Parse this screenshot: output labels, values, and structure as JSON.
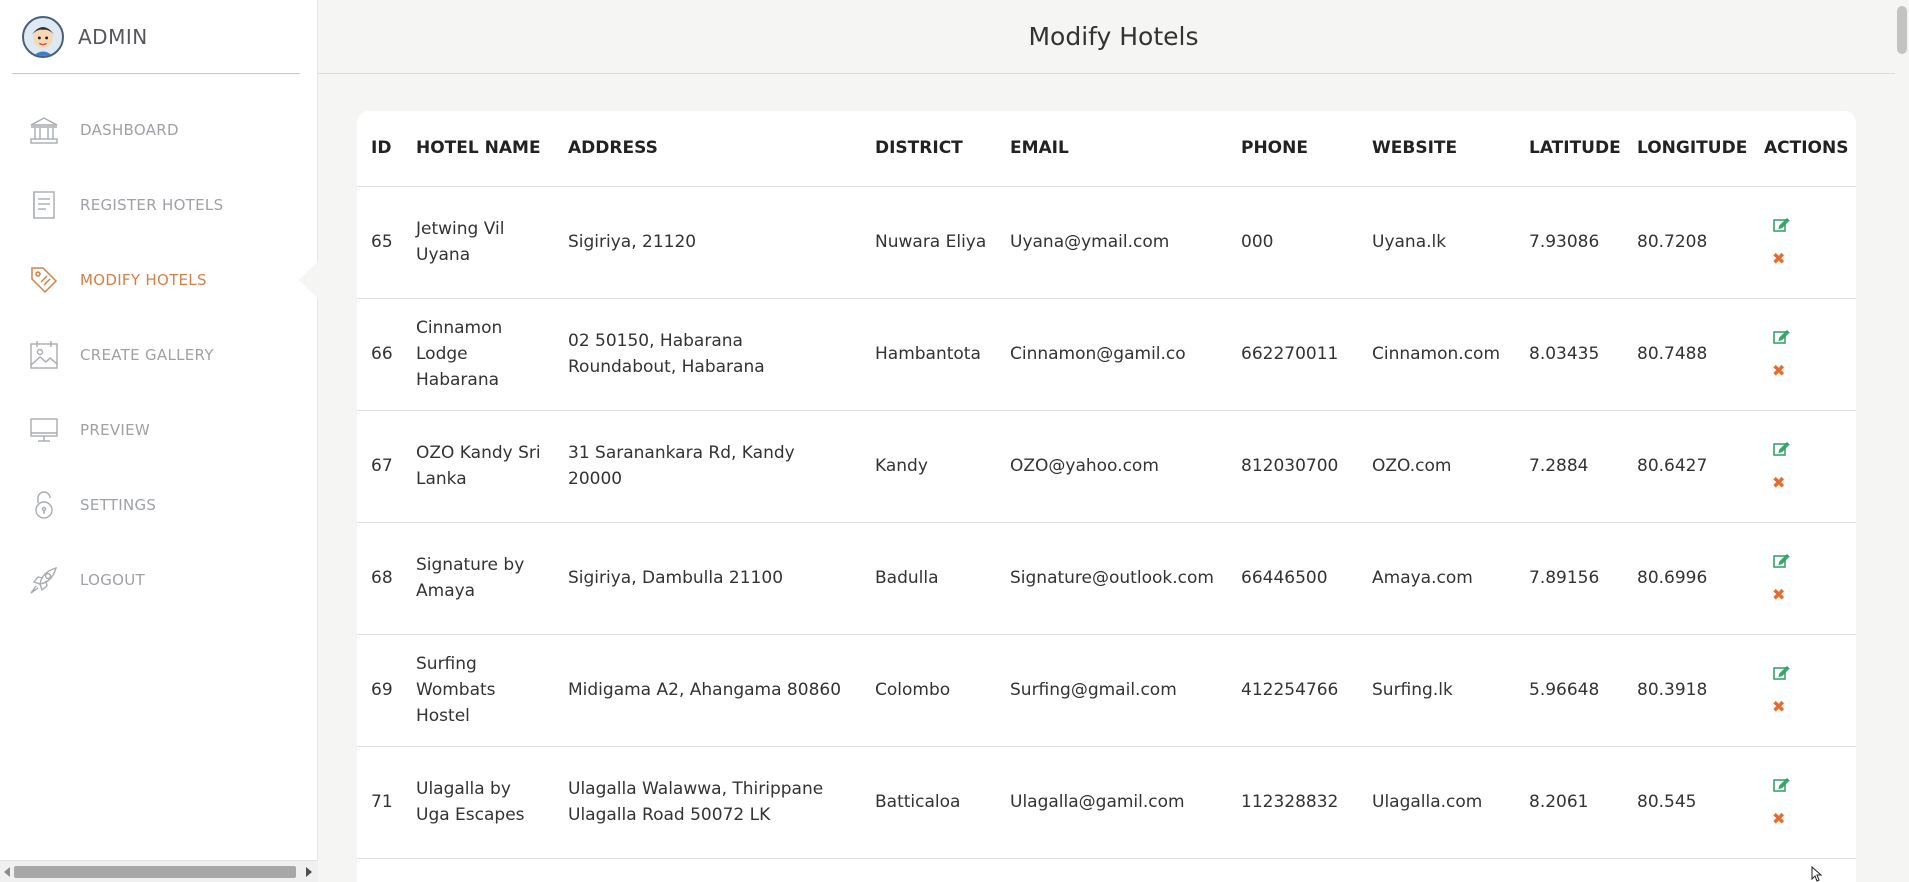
{
  "sidebar": {
    "brand": "ADMIN",
    "items": [
      {
        "label": "DASHBOARD",
        "icon": "bank-icon"
      },
      {
        "label": "REGISTER HOTELS",
        "icon": "document-icon"
      },
      {
        "label": "MODIFY HOTELS",
        "icon": "tag-icon",
        "active": true
      },
      {
        "label": "CREATE GALLERY",
        "icon": "gallery-icon"
      },
      {
        "label": "PREVIEW",
        "icon": "monitor-icon"
      },
      {
        "label": "SETTINGS",
        "icon": "lock-icon"
      },
      {
        "label": "LOGOUT",
        "icon": "rocket-icon"
      }
    ]
  },
  "header": {
    "title": "Modify Hotels"
  },
  "table": {
    "columns": [
      "ID",
      "HOTEL NAME",
      "ADDRESS",
      "DISTRICT",
      "EMAIL",
      "PHONE",
      "WEBSITE",
      "LATITUDE",
      "LONGITUDE",
      "ACTIONS"
    ],
    "rows": [
      [
        "65",
        "Jetwing Vil Uyana",
        "Sigiriya, 21120",
        "Nuwara Eliya",
        "Uyana@ymail.com",
        "000",
        "Uyana.lk",
        "7.93086",
        "80.7208"
      ],
      [
        "66",
        "Cinnamon Lodge Habarana",
        "02 50150, Habarana Roundabout, Habarana",
        "Hambantota",
        "Cinnamon@gamil.co",
        "662270011",
        "Cinnamon.com",
        "8.03435",
        "80.7488"
      ],
      [
        "67",
        "OZO Kandy Sri Lanka",
        "31 Saranankara Rd, Kandy 20000",
        "Kandy",
        "OZO@yahoo.com",
        "812030700",
        "OZO.com",
        "7.2884",
        "80.6427"
      ],
      [
        "68",
        "Signature by Amaya",
        "Sigiriya, Dambulla 21100",
        "Badulla",
        "Signature@outlook.com",
        "66446500",
        "Amaya.com",
        "7.89156",
        "80.6996"
      ],
      [
        "69",
        "Surfing Wombats Hostel",
        "Midigama A2, Ahangama 80860",
        "Colombo",
        "Surfing@gmail.com",
        "412254766",
        "Surfing.lk",
        "5.96648",
        "80.3918"
      ],
      [
        "71",
        "Ulagalla by Uga Escapes",
        "Ulagalla Walawwa, Thirippane Ulagalla Road 50072 LK",
        "Batticaloa",
        "Ulagalla@gamil.com",
        "112328832",
        "Ulagalla.com",
        "8.2061",
        "80.545"
      ]
    ]
  },
  "colors": {
    "accent": "#d4804a",
    "edit": "#3aa56b",
    "delete": "#e56c33"
  }
}
